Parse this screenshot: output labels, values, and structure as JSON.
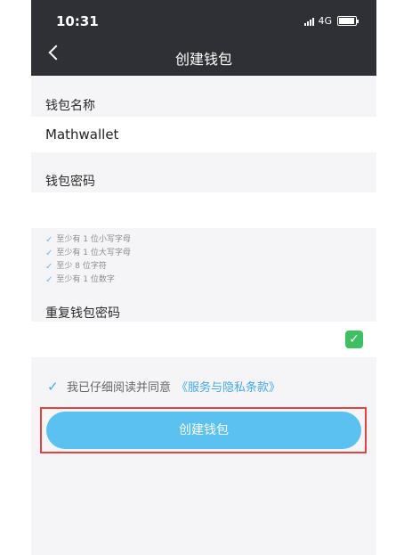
{
  "status": {
    "time": "10:31",
    "network": "4G"
  },
  "header": {
    "title": "创建钱包"
  },
  "wallet_name": {
    "label": "钱包名称",
    "value": "Mathwallet"
  },
  "wallet_password": {
    "label": "钱包密码",
    "rules": [
      "至少有 1 位小写字母",
      "至少有 1 位大写字母",
      "至少 8 位字符",
      "至少有 1 位数字"
    ]
  },
  "repeat_password": {
    "label": "重复钱包密码"
  },
  "agreement": {
    "text": "我已仔细阅读并同意",
    "link": "《服务与隐私条款》"
  },
  "create_button": {
    "label": "创建钱包"
  },
  "colors": {
    "header": "#2e3035",
    "button": "#5bc1f0",
    "link": "#45a8ea",
    "highlight": "#e34242",
    "success": "#3fbf62"
  }
}
